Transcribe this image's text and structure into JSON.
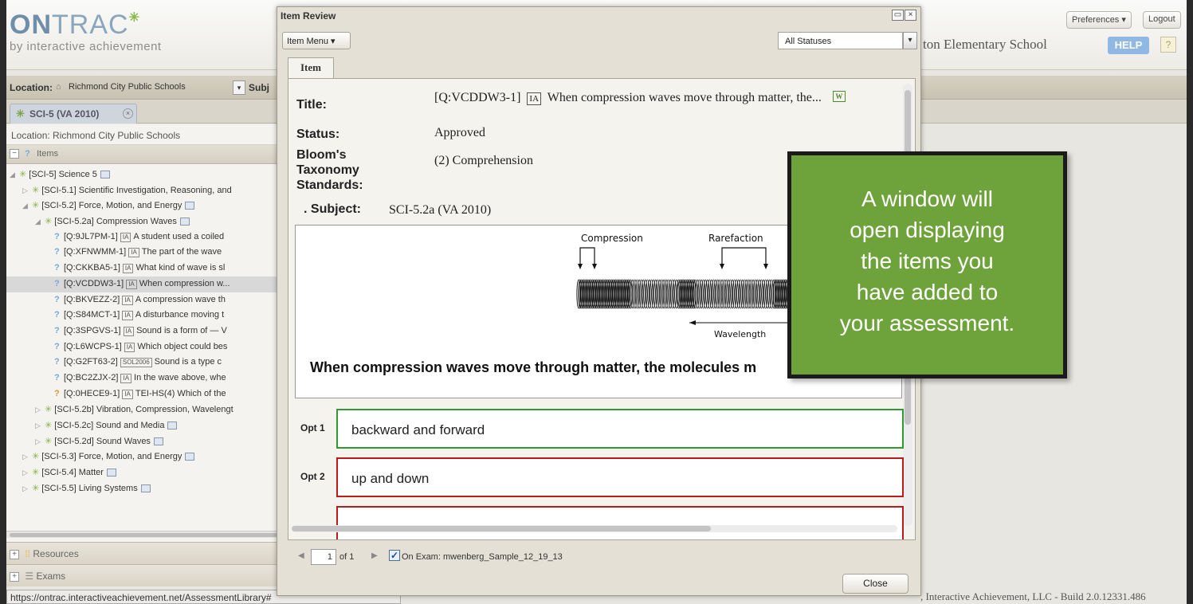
{
  "header": {
    "logo_on": "ON",
    "logo_trac": "TRAC",
    "tagline": "by interactive achievement",
    "preferences": "Preferences ▾",
    "logout": "Logout",
    "school": "ton Elementary School",
    "help": "HELP",
    "help_q": "?"
  },
  "location_bar": {
    "label": "Location:",
    "value": "Richmond City Public Schools",
    "subject_label": "Subj"
  },
  "doc_tab": {
    "label": "SCI-5 (VA 2010)"
  },
  "left_panel": {
    "location_line": "Location: Richmond City Public Schools",
    "items_header": "Items",
    "tree": [
      {
        "indent": 4,
        "kind": "folder",
        "text": "[SCI-5] Science 5",
        "icon": true,
        "open": true
      },
      {
        "indent": 20,
        "kind": "folder",
        "text": "[SCI-5.1] Scientific Investigation, Reasoning, and",
        "icon": false,
        "open": false
      },
      {
        "indent": 20,
        "kind": "folder",
        "text": "[SCI-5.2] Force, Motion, and Energy",
        "icon": true,
        "open": true
      },
      {
        "indent": 36,
        "kind": "folder",
        "text": "[SCI-5.2a] Compression Waves",
        "icon": true,
        "open": true
      },
      {
        "indent": 60,
        "kind": "item",
        "code": "[Q:9JL7PM-1]",
        "tag": "IA",
        "text": "A student used a coiled"
      },
      {
        "indent": 60,
        "kind": "item",
        "code": "[Q:XFNWMM-1]",
        "tag": "IA",
        "text": "The part of the wave"
      },
      {
        "indent": 60,
        "kind": "item",
        "code": "[Q:CKKBA5-1]",
        "tag": "IA",
        "text": "What kind of wave is sl"
      },
      {
        "indent": 60,
        "kind": "item",
        "code": "[Q:VCDDW3-1]",
        "tag": "IA",
        "text": "When compression w...",
        "selected": true
      },
      {
        "indent": 60,
        "kind": "item",
        "code": "[Q:BKVEZZ-2]",
        "tag": "IA",
        "text": "A compression wave th"
      },
      {
        "indent": 60,
        "kind": "item",
        "code": "[Q:S84MCT-1]",
        "tag": "IA",
        "text": "A disturbance moving t"
      },
      {
        "indent": 60,
        "kind": "item",
        "code": "[Q:3SPGVS-1]",
        "tag": "IA",
        "text": "Sound is a form of — V"
      },
      {
        "indent": 60,
        "kind": "item",
        "code": "[Q:L6WCPS-1]",
        "tag": "IA",
        "text": "Which object could bes"
      },
      {
        "indent": 60,
        "kind": "item",
        "code": "[Q:G2FT63-2]",
        "tag": "SOL2006",
        "text": "Sound is a type c"
      },
      {
        "indent": 60,
        "kind": "item",
        "code": "[Q:BC2ZJX-2]",
        "tag": "IA",
        "text": "In the wave above, whe"
      },
      {
        "indent": 60,
        "kind": "item",
        "code": "[Q:0HECE9-1]",
        "tag": "IA",
        "text": "TEI-HS(4) Which of the",
        "orange": true
      },
      {
        "indent": 36,
        "kind": "folder",
        "text": "[SCI-5.2b] Vibration, Compression, Wavelengt",
        "icon": false,
        "open": false
      },
      {
        "indent": 36,
        "kind": "folder",
        "text": "[SCI-5.2c] Sound and Media",
        "icon": true,
        "open": false
      },
      {
        "indent": 36,
        "kind": "folder",
        "text": "[SCI-5.2d] Sound Waves",
        "icon": true,
        "open": false
      },
      {
        "indent": 20,
        "kind": "folder",
        "text": "[SCI-5.3] Force, Motion, and Energy",
        "icon": true,
        "open": false
      },
      {
        "indent": 20,
        "kind": "folder",
        "text": "[SCI-5.4] Matter",
        "icon": true,
        "open": false
      },
      {
        "indent": 20,
        "kind": "folder",
        "text": "[SCI-5.5] Living Systems",
        "icon": true,
        "open": false
      }
    ],
    "resources": "Resources",
    "exams": "Exams"
  },
  "status_url": "https://ontrac.interactiveachievement.net/AssessmentLibrary#",
  "footer_right": ", Interactive Achievement, LLC - Build 2.0.12331.486",
  "modal": {
    "title": "Item Review",
    "item_menu": "Item Menu ▾",
    "status_filter": "All Statuses",
    "tab": "Item",
    "fields": {
      "title_label": "Title:",
      "title_code": "[Q:VCDDW3-1]",
      "title_tag": "IA",
      "title_text": "When compression waves move through matter, the...",
      "title_badge": "W",
      "status_label": "Status:",
      "status_value": "Approved",
      "bloom_label_1": "Bloom's",
      "bloom_label_2": "Taxonomy",
      "bloom_value": "(2) Comprehension",
      "standards_label": "Standards:",
      "subject_label": ". Subject:",
      "subject_value": "SCI-5.2a (VA 2010)"
    },
    "stimulus": {
      "compression": "Compression",
      "rarefaction": "Rarefaction",
      "wavelength": "Wavelength",
      "question": "When compression waves move through matter, the molecules m"
    },
    "options": [
      {
        "label": "Opt 1",
        "text": "backward and forward",
        "correct": true
      },
      {
        "label": "Opt 2",
        "text": "up and down",
        "correct": false
      },
      {
        "label": "",
        "text": "",
        "correct": false
      }
    ],
    "pager": {
      "page": "1",
      "of": "of 1",
      "on_exam": "On Exam: mwenberg_Sample_12_19_13"
    },
    "close": "Close"
  },
  "callout": {
    "lines": [
      "A window will",
      "open displaying",
      "the items you",
      "have added to",
      "your assessment."
    ]
  },
  "colors": {
    "accent_green": "#6ea33b",
    "correct_border": "#2f9a2f",
    "incorrect_border": "#bb1b1b"
  }
}
